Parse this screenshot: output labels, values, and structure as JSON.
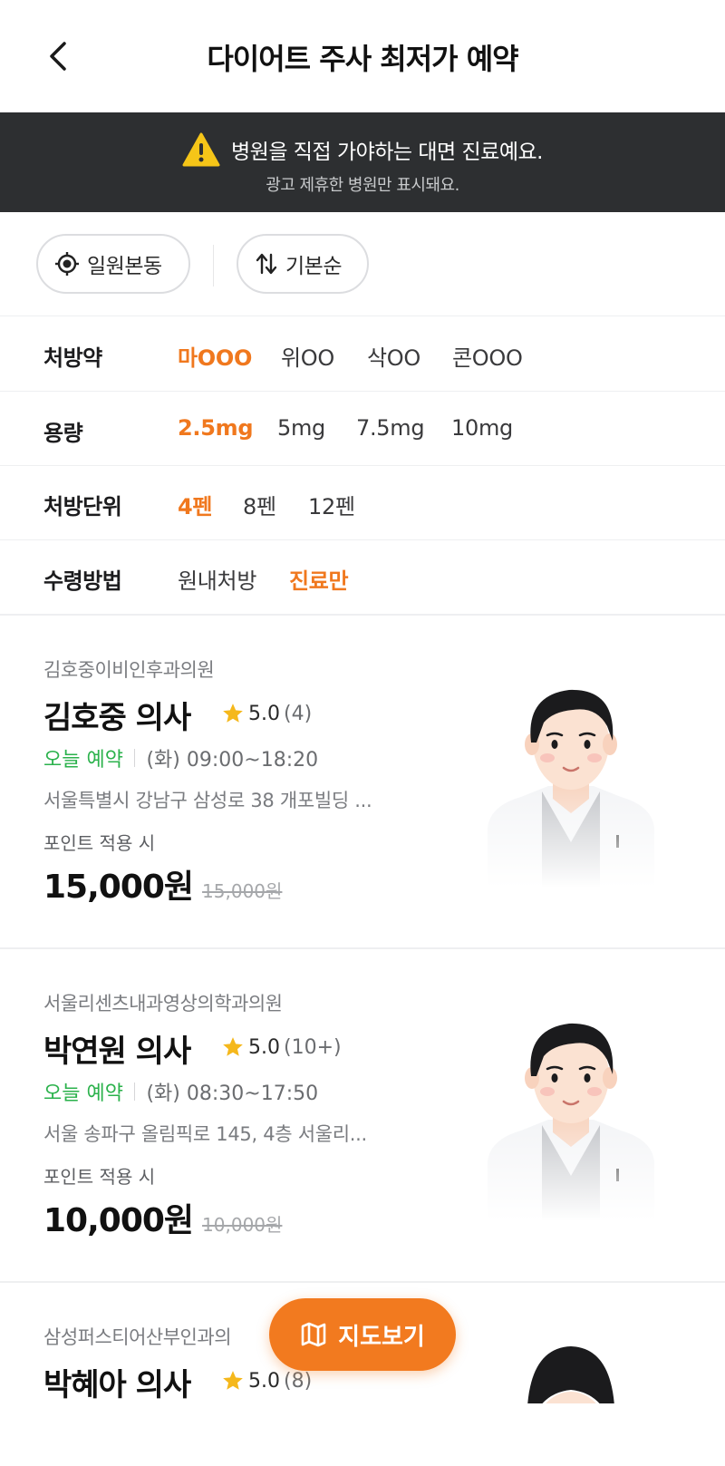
{
  "header": {
    "title": "다이어트 주사 최저가 예약",
    "back_icon": "chevron-left-icon"
  },
  "notice": {
    "line1": "병원을 직접 가야하는 대면 진료예요.",
    "line2": "광고 제휴한 병원만 표시돼요.",
    "icon": "warning-icon",
    "icon_color": "#f5c518"
  },
  "filters": {
    "location": "일원본동",
    "sort": "기본순"
  },
  "options": {
    "medicine": {
      "label": "처방약",
      "items": [
        "마OOO",
        "위OO",
        "삭OO",
        "콘OOO"
      ],
      "selected": "마OOO"
    },
    "dose": {
      "label": "용량",
      "items": [
        "2.5mg",
        "5mg",
        "7.5mg",
        "10mg"
      ],
      "selected": "2.5mg"
    },
    "unit": {
      "label": "처방단위",
      "items": [
        "4펜",
        "8펜",
        "12펜"
      ],
      "selected": "4펜"
    },
    "receive": {
      "label": "수령방법",
      "items": [
        "원내처방",
        "진료만"
      ],
      "selected": "진료만"
    }
  },
  "doctors": [
    {
      "clinic": "김호중이비인후과의원",
      "name": "김호중 의사",
      "rating": "5.0",
      "count": "(4)",
      "availability": "오늘 예약",
      "hours": "(화) 09:00~18:20",
      "address": "서울특별시 강남구 삼성로 38 개포빌딩 ...",
      "point_label": "포인트 적용 시",
      "price": "15,000원",
      "original_price": "15,000원"
    },
    {
      "clinic": "서울리센츠내과영상의학과의원",
      "name": "박연원 의사",
      "rating": "5.0",
      "count": "(10+)",
      "availability": "오늘 예약",
      "hours": "(화) 08:30~17:50",
      "address": "서울 송파구 올림픽로 145, 4층 서울리...",
      "point_label": "포인트 적용 시",
      "price": "10,000원",
      "original_price": "10,000원"
    },
    {
      "clinic": "삼성퍼스티어산부인과의",
      "name": "박혜아 의사",
      "rating": "5.0",
      "count": "(8)"
    }
  ],
  "map_button": {
    "label": "지도보기",
    "icon": "map-icon"
  },
  "colors": {
    "accent": "#f27a1f",
    "selected_option": "#f0781e",
    "available": "#2bb24c",
    "notice_bg": "#2d2f31",
    "star": "#f5b81c"
  }
}
